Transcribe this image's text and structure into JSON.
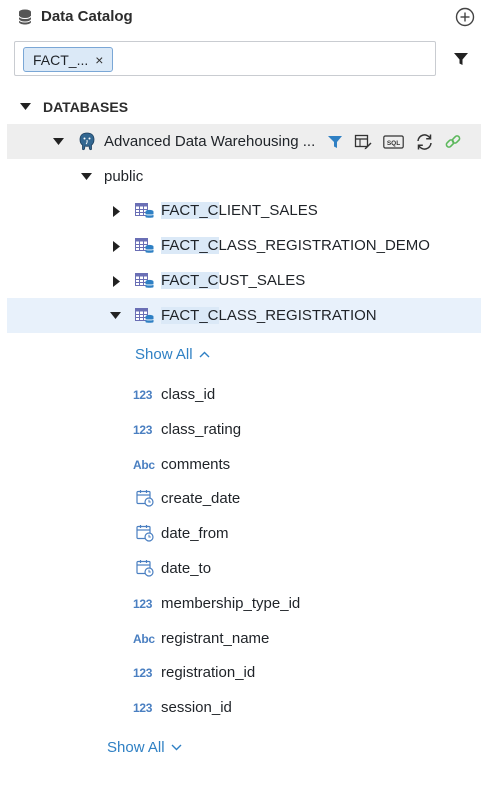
{
  "header": {
    "title": "Data Catalog",
    "icon": "database-icon",
    "add_icon": "plus-circle-icon"
  },
  "filter": {
    "chip_label": "FACT_...",
    "chip_close": "×",
    "filter_icon": "funnel-icon"
  },
  "tree": {
    "section_label": "DATABASES",
    "database": {
      "name": "Advanced Data Warehousing ...",
      "icon": "postgresql-elephant-icon",
      "actions": [
        "filter-icon",
        "table-edit-icon",
        "sql-icon",
        "refresh-icon",
        "link-icon"
      ],
      "sql_label": "SQL"
    },
    "schema": {
      "name": "public"
    },
    "tables": [
      {
        "match": "FACT_C",
        "rest": "LIENT_SALES",
        "expanded": false
      },
      {
        "match": "FACT_C",
        "rest": "LASS_REGISTRATION_DEMO",
        "expanded": false
      },
      {
        "match": "FACT_C",
        "rest": "UST_SALES",
        "expanded": false
      },
      {
        "match": "FACT_C",
        "rest": "LASS_REGISTRATION",
        "expanded": true
      }
    ],
    "show_all_inner": "Show All",
    "columns": [
      {
        "type_label": "123",
        "name": "class_id",
        "type": "number"
      },
      {
        "type_label": "123",
        "name": "class_rating",
        "type": "number"
      },
      {
        "type_label": "Abc",
        "name": "comments",
        "type": "text"
      },
      {
        "type_label": "",
        "name": "create_date",
        "type": "date"
      },
      {
        "type_label": "",
        "name": "date_from",
        "type": "date"
      },
      {
        "type_label": "",
        "name": "date_to",
        "type": "date"
      },
      {
        "type_label": "123",
        "name": "membership_type_id",
        "type": "number"
      },
      {
        "type_label": "Abc",
        "name": "registrant_name",
        "type": "text"
      },
      {
        "type_label": "123",
        "name": "registration_id",
        "type": "number"
      },
      {
        "type_label": "123",
        "name": "session_id",
        "type": "number"
      }
    ],
    "show_all_outer": "Show All"
  },
  "colors": {
    "accent": "#2f80c4",
    "highlight": "#dbe9f7",
    "selected_row": "#e8f1fb",
    "db_row": "#eeeeee",
    "link_green": "#5cb85c"
  }
}
